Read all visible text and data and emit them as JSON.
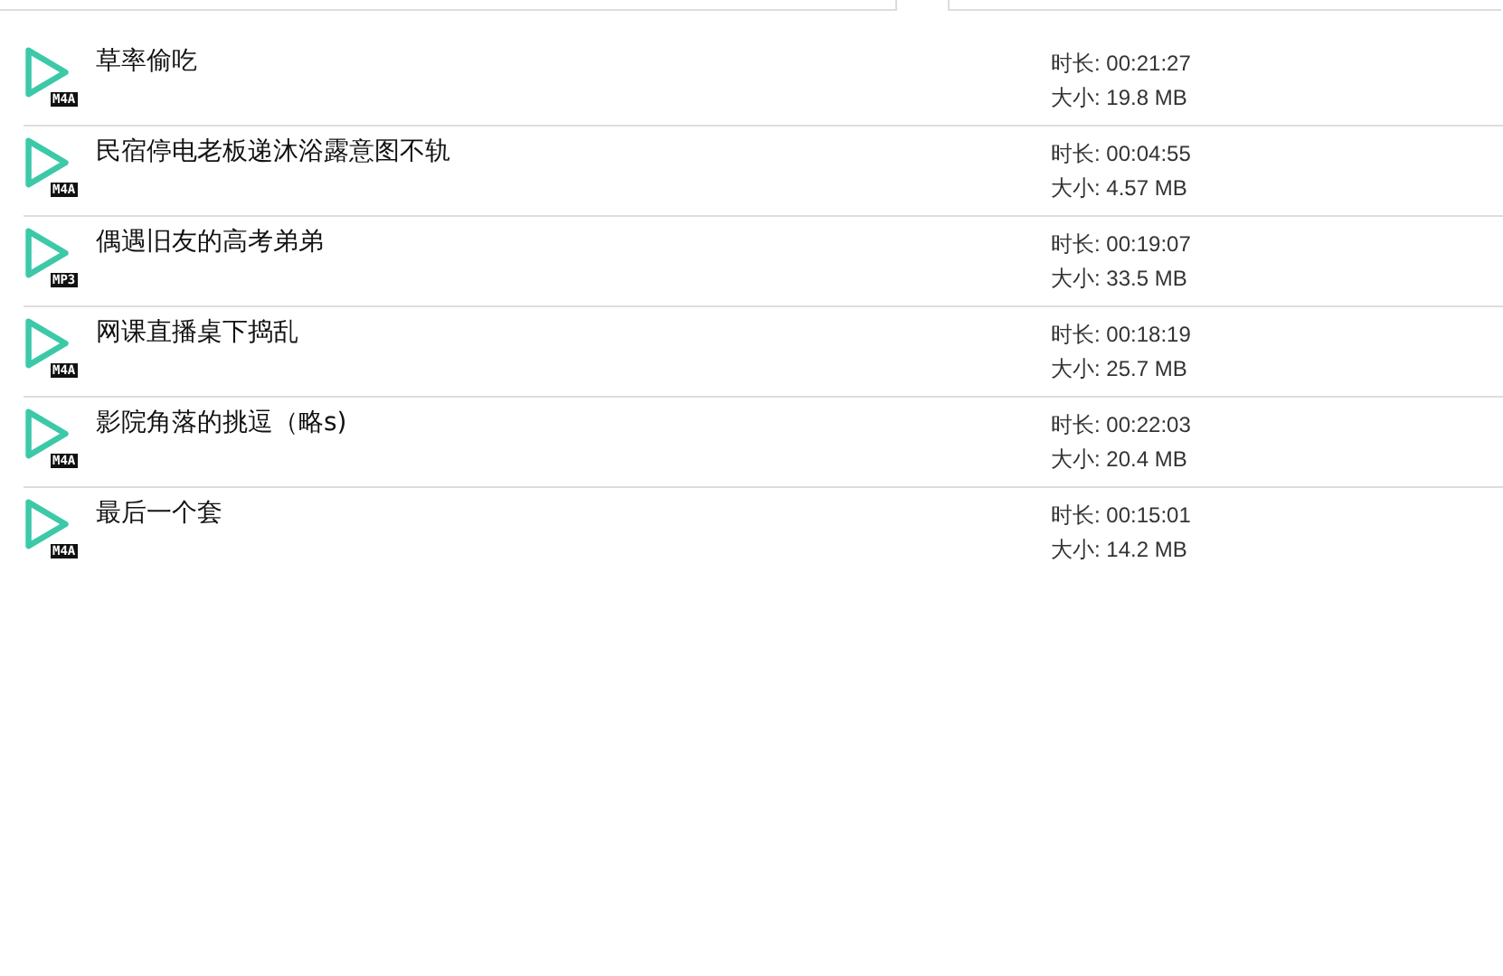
{
  "files": [
    {
      "title": "草率偷吃",
      "format": "M4A",
      "duration": "时长: 00:21:27",
      "size": "大小: 19.8 MB"
    },
    {
      "title": "民宿停电老板递沐浴露意图不轨",
      "format": "M4A",
      "duration": "时长: 00:04:55",
      "size": "大小: 4.57 MB"
    },
    {
      "title": "偶遇旧友的高考弟弟",
      "format": "MP3",
      "duration": "时长: 00:19:07",
      "size": "大小: 33.5 MB"
    },
    {
      "title": "网课直播桌下捣乱",
      "format": "M4A",
      "duration": "时长: 00:18:19",
      "size": "大小: 25.7 MB"
    },
    {
      "title": "影院角落的挑逗（略s)",
      "format": "M4A",
      "duration": "时长: 00:22:03",
      "size": "大小: 20.4 MB"
    },
    {
      "title": "最后一个套",
      "format": "M4A",
      "duration": "时长: 00:15:01",
      "size": "大小: 14.2 MB"
    }
  ]
}
